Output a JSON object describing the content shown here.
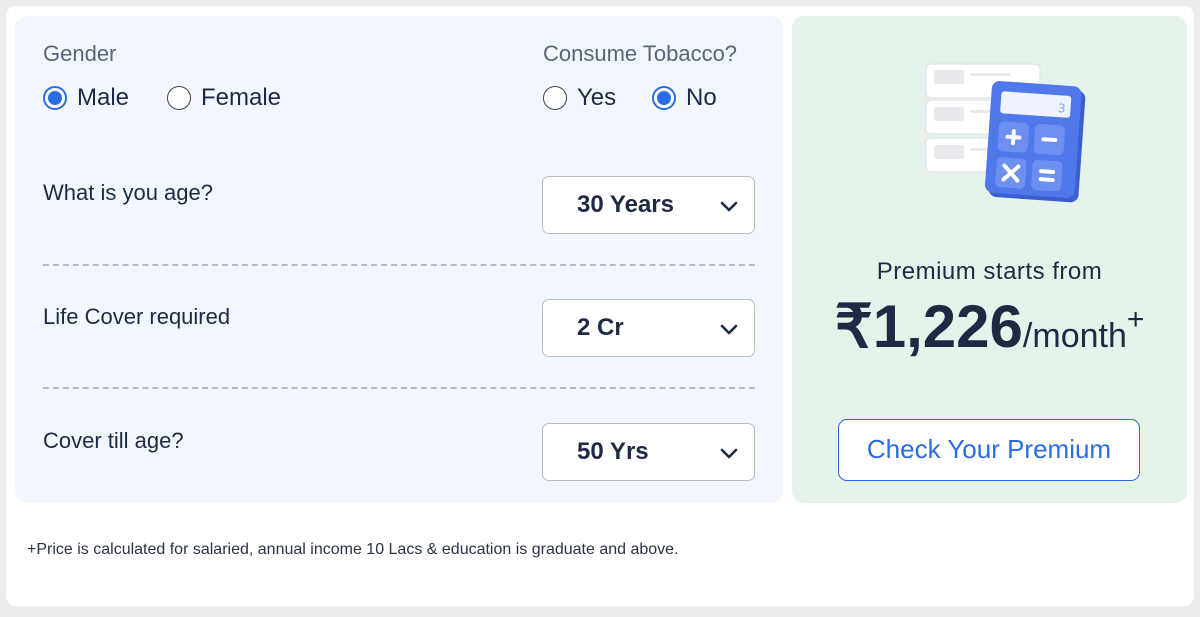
{
  "gender": {
    "label": "Gender",
    "options": [
      {
        "label": "Male",
        "selected": true
      },
      {
        "label": "Female",
        "selected": false
      }
    ]
  },
  "tobacco": {
    "label": "Consume Tobacco?",
    "options": [
      {
        "label": "Yes",
        "selected": false
      },
      {
        "label": "No",
        "selected": true
      }
    ]
  },
  "age": {
    "question": "What is you age?",
    "value": "30 Years"
  },
  "cover": {
    "question": "Life Cover required",
    "value": "2 Cr"
  },
  "cover_till": {
    "question": "Cover till age?",
    "value": "50 Yrs"
  },
  "premium": {
    "label": "Premium starts from",
    "amount": "₹1,226",
    "per": "/month",
    "plus": "+",
    "button": "Check Your Premium"
  },
  "footnote": "+Price is calculated for salaried, annual income 10 Lacs & education is graduate and above.",
  "colors": {
    "accent": "#2b6de0",
    "left_panel_bg": "#f1f7fd",
    "right_panel_bg": "#e6f3ea",
    "text": "#1e2a44"
  },
  "icons": {
    "illustration": "calculator-illustration",
    "dropdown": "chevron-down-icon"
  }
}
